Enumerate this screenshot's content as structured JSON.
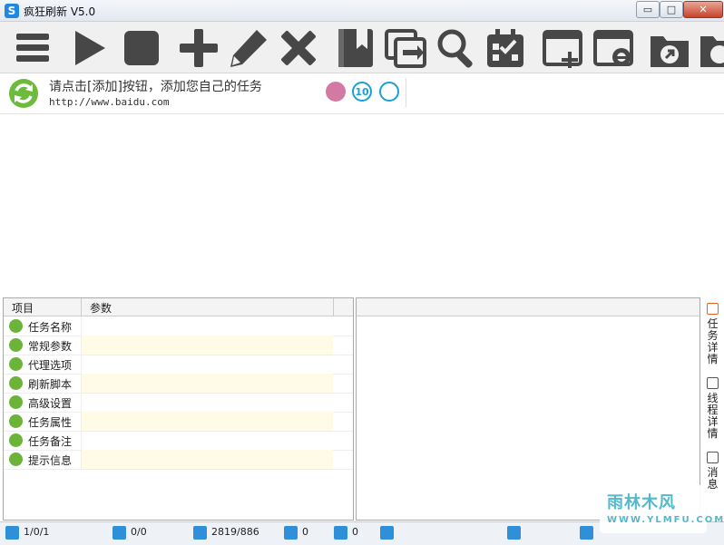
{
  "window": {
    "title": "疯狂刷新 V5.0",
    "icon_letter": "S",
    "min_glyph": "▭",
    "max_glyph": "□",
    "close_glyph": "✕"
  },
  "toolbar": {
    "buttons": [
      {
        "icon": "menu-icon"
      },
      {
        "icon": "play-icon"
      },
      {
        "icon": "stop-icon"
      },
      {
        "icon": "add-icon"
      },
      {
        "icon": "edit-icon"
      },
      {
        "icon": "delete-icon"
      },
      {
        "icon": "bookmark-icon"
      },
      {
        "icon": "copy-icon"
      },
      {
        "icon": "search-icon"
      },
      {
        "icon": "calendar-icon"
      },
      {
        "icon": "new-window-icon"
      },
      {
        "icon": "ie-window-icon"
      },
      {
        "icon": "folder-export-icon"
      },
      {
        "icon": "folder-import-icon"
      }
    ]
  },
  "task": {
    "hint": "请点击[添加]按钮，添加您自己的任务",
    "url": "http://www.baidu.com",
    "badge_number": "10"
  },
  "grid": {
    "headers": [
      "项目",
      "参数"
    ],
    "rows": [
      {
        "label": "任务名称",
        "icon": "user-icon"
      },
      {
        "label": "常规参数",
        "icon": "list-icon"
      },
      {
        "label": "代理选项",
        "icon": "network-icon"
      },
      {
        "label": "刷新脚本",
        "icon": "script-icon"
      },
      {
        "label": "高级设置",
        "icon": "settings-icon"
      },
      {
        "label": "任务属性",
        "icon": "properties-icon"
      },
      {
        "label": "任务备注",
        "icon": "notes-icon"
      },
      {
        "label": "提示信息",
        "icon": "message-icon"
      }
    ]
  },
  "sidetabs": [
    {
      "label": "任务详情"
    },
    {
      "label": "线程详情"
    },
    {
      "label": "消息"
    }
  ],
  "status": {
    "s1": "1/0/1",
    "s2": "0/0",
    "s3": "2819/886",
    "s4": "0",
    "s5": "0"
  },
  "watermark": {
    "line1": "雨林木风",
    "line2": "WWW.YLMFU.COM"
  },
  "colors": {
    "accent_green": "#6cb33a",
    "accent_blue": "#1aa0d8",
    "tab_active": "#e8641b",
    "row_highlight": "#fffbe6"
  }
}
